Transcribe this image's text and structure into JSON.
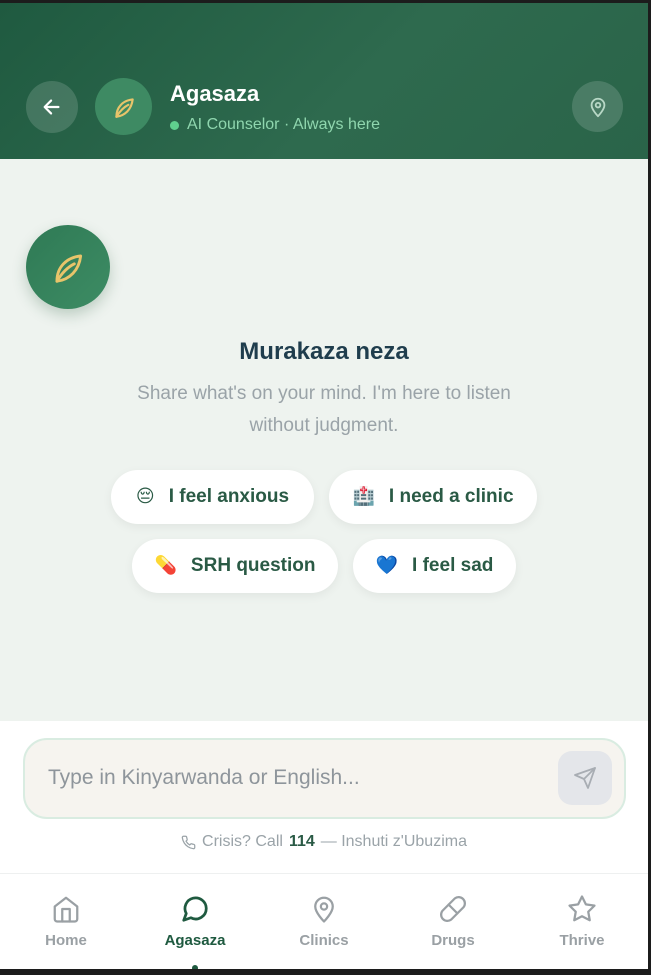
{
  "header": {
    "title": "Agasaza",
    "subtitle": "AI Counselor · Always here",
    "back_icon": "arrow-left-icon",
    "avatar_icon": "leaf-icon",
    "location_icon": "map-pin-icon"
  },
  "welcome": {
    "title": "Murakaza neza",
    "subtitle": "Share what's on your mind. I'm here to listen without judgment."
  },
  "suggestions": [
    {
      "emoji": "😔",
      "label": "I feel anxious"
    },
    {
      "emoji": "🏥",
      "label": "I need a clinic"
    },
    {
      "emoji": "💊",
      "label": "SRH question"
    },
    {
      "emoji": "💙",
      "label": "I feel sad"
    }
  ],
  "composer": {
    "placeholder": "Type in Kinyarwanda or English...",
    "value": "",
    "send_icon": "send-icon"
  },
  "crisis": {
    "prefix": "Crisis? Call",
    "number": "114",
    "suffix": "— Inshuti z'Ubuzima"
  },
  "nav": {
    "active": "Agasaza",
    "items": [
      {
        "label": "Home",
        "icon": "home-icon"
      },
      {
        "label": "Agasaza",
        "icon": "chat-bubble-icon"
      },
      {
        "label": "Clinics",
        "icon": "map-pin-icon"
      },
      {
        "label": "Drugs",
        "icon": "pill-icon"
      },
      {
        "label": "Thrive",
        "icon": "star-icon"
      }
    ]
  },
  "colors": {
    "primary": "#1f5a40",
    "accent": "#3d8c64",
    "leaf": "#e8c46a",
    "background": "#eef3ef",
    "online": "#5fd08e"
  }
}
